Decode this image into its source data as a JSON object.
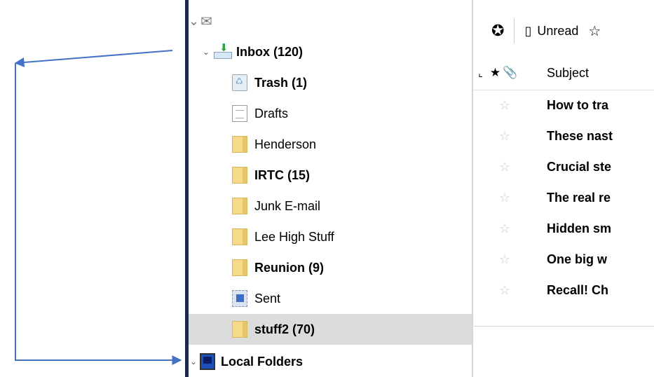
{
  "folder_pane": {
    "account_icon": "envelope-icon",
    "folders": [
      {
        "label": "Inbox (120)",
        "icon": "inbox-icon",
        "bold": true,
        "expanded": true
      },
      {
        "label": "Trash (1)",
        "icon": "trash-icon",
        "bold": true
      },
      {
        "label": "Drafts",
        "icon": "drafts-icon",
        "bold": false
      },
      {
        "label": "Henderson",
        "icon": "folder-icon",
        "bold": false
      },
      {
        "label": "IRTC (15)",
        "icon": "folder-icon",
        "bold": true
      },
      {
        "label": "Junk E-mail",
        "icon": "folder-icon",
        "bold": false
      },
      {
        "label": "Lee High Stuff",
        "icon": "folder-icon",
        "bold": false
      },
      {
        "label": "Reunion (9)",
        "icon": "folder-icon",
        "bold": true
      },
      {
        "label": "Sent",
        "icon": "sent-icon",
        "bold": false
      },
      {
        "label": "stuff2 (70)",
        "icon": "folder-icon",
        "bold": true,
        "selected": true
      }
    ],
    "local_folders": {
      "label": "Local Folders",
      "icon": "computer-icon"
    }
  },
  "toolbar": {
    "unread_label": "Unread"
  },
  "message_list": {
    "headers": {
      "subject": "Subject"
    },
    "messages": [
      {
        "subject": "How to tra"
      },
      {
        "subject": "These nast"
      },
      {
        "subject": "Crucial ste"
      },
      {
        "subject": "The real re"
      },
      {
        "subject": "Hidden sm"
      },
      {
        "subject": "One big w"
      },
      {
        "subject": "Recall! Ch"
      }
    ]
  },
  "colors": {
    "annotation_arrow": "#4472c4",
    "selected_row": "#dcdcdc",
    "left_bar": "#1b2a4a",
    "folder_yellow": "#f6d98a"
  }
}
